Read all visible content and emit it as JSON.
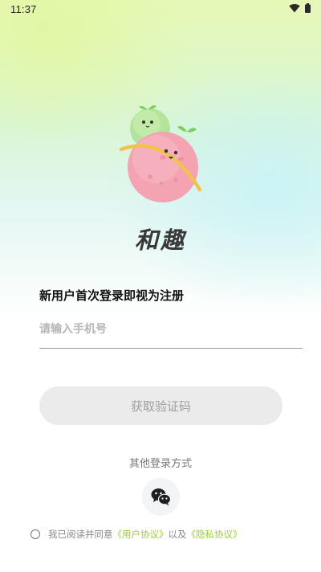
{
  "status_bar": {
    "time": "11:37",
    "icons": [
      "wifi-icon",
      "battery-icon"
    ]
  },
  "app": {
    "name": "和趣",
    "mascot_icon": "planet-mascot-icon"
  },
  "login": {
    "register_hint": "新用户首次登录即视为注册",
    "phone_placeholder": "请输入手机号",
    "get_code_label": "获取验证码",
    "other_login_label": "其他登录方式",
    "wechat_icon": "wechat-icon"
  },
  "agreement": {
    "prefix": "我已阅读并同意",
    "user_agreement": "《用户协议》",
    "connector": "以及",
    "privacy_policy": "《隐私协议》",
    "link_color": "#9ccd2f"
  },
  "colors": {
    "accent": "#9ccd2f",
    "button_bg": "#ebebeb",
    "button_text": "#9e9e9e"
  }
}
